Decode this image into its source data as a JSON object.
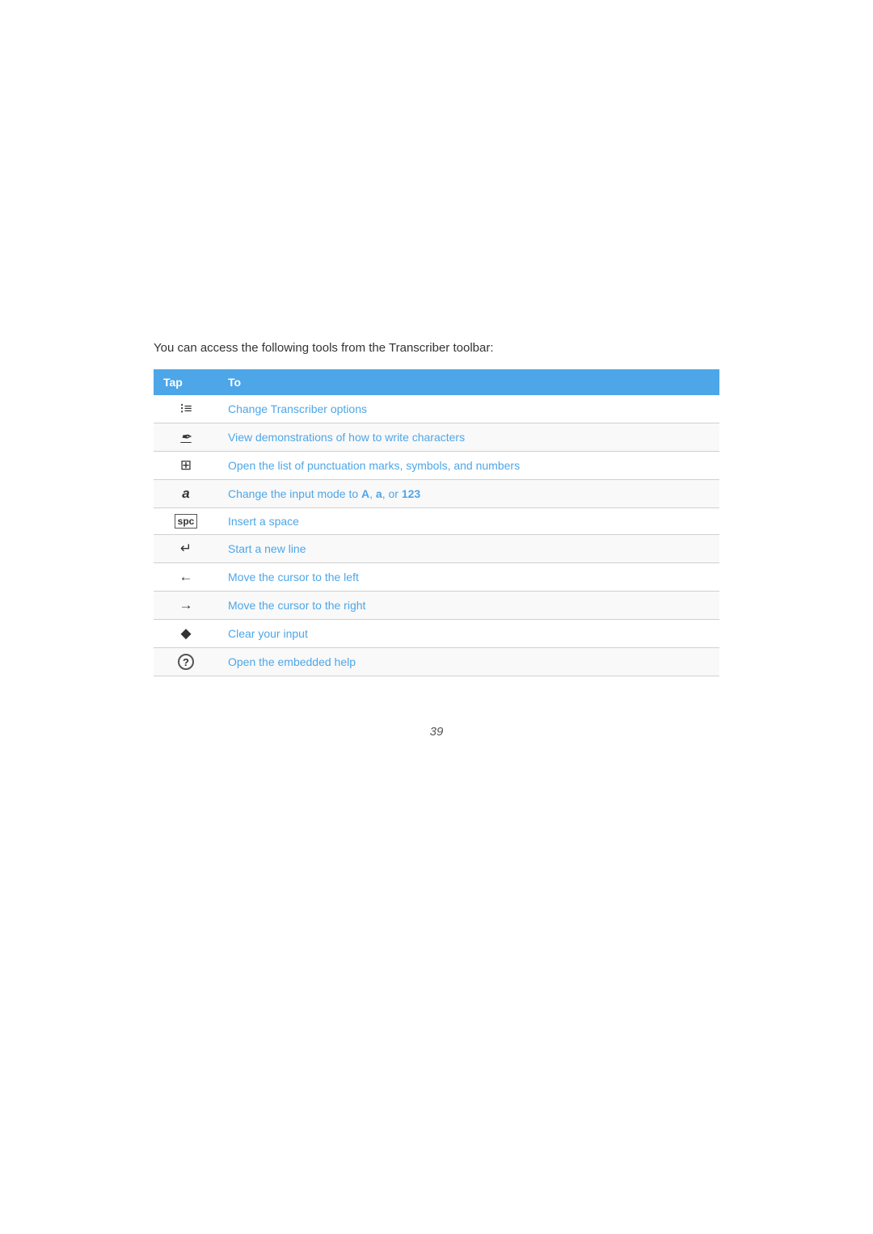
{
  "intro": {
    "text": "You can access the following tools from the Transcriber toolbar:"
  },
  "table": {
    "header": {
      "col1": "Tap",
      "col2": "To"
    },
    "rows": [
      {
        "icon": "☰",
        "icon_label": "transcriber-options-icon",
        "action": "Change Transcriber options",
        "action_key": "change-transcriber-options"
      },
      {
        "icon": "✎",
        "icon_label": "view-demonstrations-icon",
        "action": "View demonstrations of how to write characters",
        "action_key": "view-demonstrations"
      },
      {
        "icon": "⊞",
        "icon_label": "punctuation-list-icon",
        "action": "Open the list of punctuation marks, symbols, and numbers",
        "action_key": "open-punctuation-list"
      },
      {
        "icon": "a",
        "icon_label": "input-mode-icon",
        "action_html": "Change the input mode to <b>A</b>, <b>a</b>, or <b>123</b>",
        "action": "Change the input mode to A, a, or 123",
        "action_key": "change-input-mode",
        "has_bold": true
      },
      {
        "icon": "spc",
        "icon_label": "insert-space-icon",
        "action": "Insert a space",
        "action_key": "insert-space"
      },
      {
        "icon": "↵",
        "icon_label": "new-line-icon",
        "action": "Start a new line",
        "action_key": "start-new-line"
      },
      {
        "icon": "←",
        "icon_label": "cursor-left-icon",
        "action": "Move the cursor to the left",
        "action_key": "move-cursor-left"
      },
      {
        "icon": "→",
        "icon_label": "cursor-right-icon",
        "action": "Move the cursor to the right",
        "action_key": "move-cursor-right"
      },
      {
        "icon": "◆",
        "icon_label": "clear-input-icon",
        "action": "Clear your input",
        "action_key": "clear-input"
      },
      {
        "icon": "?",
        "icon_label": "help-icon",
        "action": "Open the embedded help",
        "action_key": "open-embedded-help"
      }
    ]
  },
  "page_number": "39"
}
